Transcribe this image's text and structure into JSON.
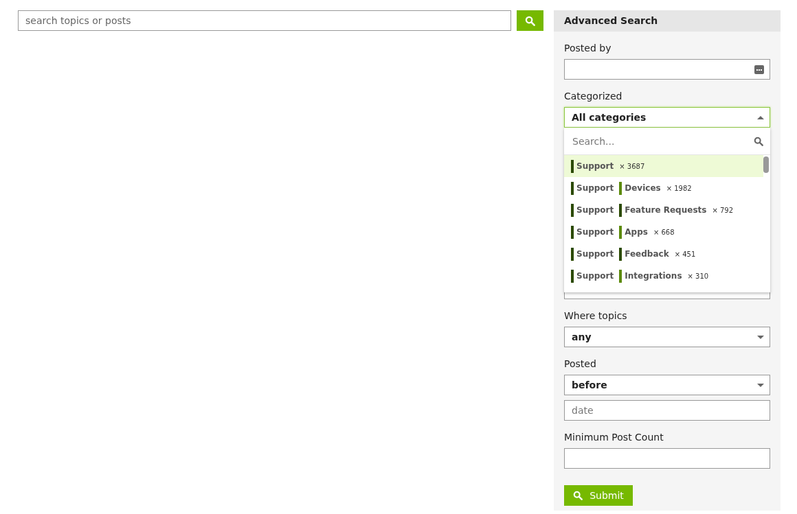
{
  "search": {
    "placeholder": "search topics or posts"
  },
  "advanced_search": {
    "title": "Advanced Search",
    "posted_by": {
      "label": "Posted by"
    },
    "categorized": {
      "label": "Categorized",
      "value": "All categories",
      "expanded": true,
      "dropdown": {
        "search_placeholder": "Search...",
        "items": [
          {
            "category": {
              "name": "Support",
              "color": "#2b4a00"
            },
            "count": "× 3687",
            "selected": true
          },
          {
            "category": {
              "name": "Support",
              "color": "#2b4a00"
            },
            "subcategory": {
              "name": "Devices",
              "color": "#5c8a0a"
            },
            "count": "× 1982",
            "selected": false
          },
          {
            "category": {
              "name": "Support",
              "color": "#2b4a00"
            },
            "subcategory": {
              "name": "Feature Requests",
              "color": "#2b4a00"
            },
            "count": "× 792",
            "selected": false
          },
          {
            "category": {
              "name": "Support",
              "color": "#2b4a00"
            },
            "subcategory": {
              "name": "Apps",
              "color": "#5c8a0a"
            },
            "count": "× 668",
            "selected": false
          },
          {
            "category": {
              "name": "Support",
              "color": "#2b4a00"
            },
            "subcategory": {
              "name": "Feedback",
              "color": "#2b4a00"
            },
            "count": "× 451",
            "selected": false
          },
          {
            "category": {
              "name": "Support",
              "color": "#2b4a00"
            },
            "subcategory": {
              "name": "Integrations",
              "color": "#5c8a0a"
            },
            "count": "× 310",
            "selected": false
          }
        ]
      }
    },
    "where_topics": {
      "label": "Where topics",
      "value": "any"
    },
    "posted": {
      "label": "Posted",
      "value": "before",
      "date_placeholder": "date"
    },
    "minimum_post_count": {
      "label": "Minimum Post Count"
    },
    "submit": {
      "label": "Submit"
    }
  }
}
